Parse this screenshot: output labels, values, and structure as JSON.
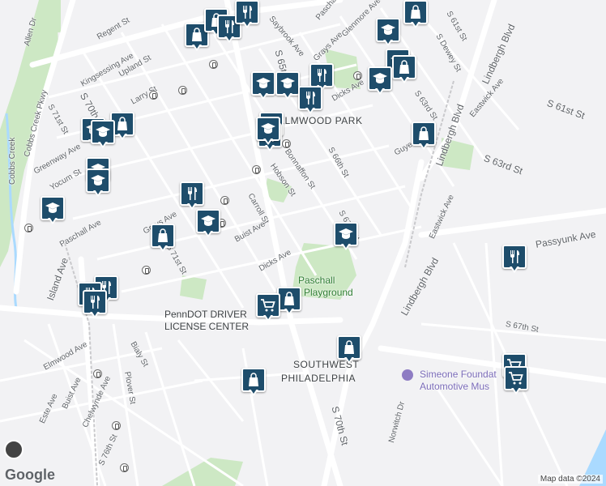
{
  "map": {
    "labels": {
      "neighborhoods": [
        "ELMWOOD PARK",
        "SOUTHWEST",
        "PHILADELPHIA"
      ],
      "parks": [
        "Paschall",
        "Playground"
      ],
      "poi": [
        "PennDOT DRIVER",
        "LICENSE CENTER"
      ],
      "museum": [
        "Simeone Foundat",
        "Automotive Mus"
      ],
      "streets": [
        "Regent St",
        "Saybrook Ave",
        "Paschall Ave",
        "Glenmore Ave",
        "S 61st St",
        "S Dewey St",
        "Lindbergh Blvd",
        "Allen Dr",
        "Kingsessing Ave",
        "Upland St",
        "S 65th St",
        "Grays Ave",
        "Larry St",
        "S 71st St",
        "S 70th St",
        "Cobbs Creek Pkwy",
        "Cobbs Creek",
        "Greenway Ave",
        "Yocum St",
        "Paschall Ave",
        "Island Ave",
        "Grays Ave",
        "Carroll St",
        "Hobson St",
        "Bonnaffon St",
        "S 66th St",
        "S 67th St",
        "Buist Ave",
        "Dicks Ave",
        "S 71st St",
        "S 63rd St",
        "Dicks Ave",
        "Guyer Ave",
        "Eastwick Ave",
        "S 63rd St",
        "S 61st St",
        "Eastwick Ave",
        "Passyunk Ave",
        "S 67th St",
        "Elmwood Ave",
        "Bialy St",
        "Buist Ave",
        "Este Ave",
        "Chelwynde Ave",
        "Plover St",
        "S 76th St",
        "S 70th St",
        "Norwitch Dr",
        "Lindbergh Blvd",
        "Lindbergh Blvd"
      ]
    },
    "attribution": "Map data ©2024",
    "logo": "Google",
    "colors": {
      "pin": "#1e4d6b",
      "park": "#cde8c4",
      "water": "#aadaff",
      "road": "#ffffff"
    },
    "pin_icons": [
      "shopping-bag-icon",
      "restaurant-icon",
      "school-icon",
      "grocery-cart-icon"
    ]
  }
}
